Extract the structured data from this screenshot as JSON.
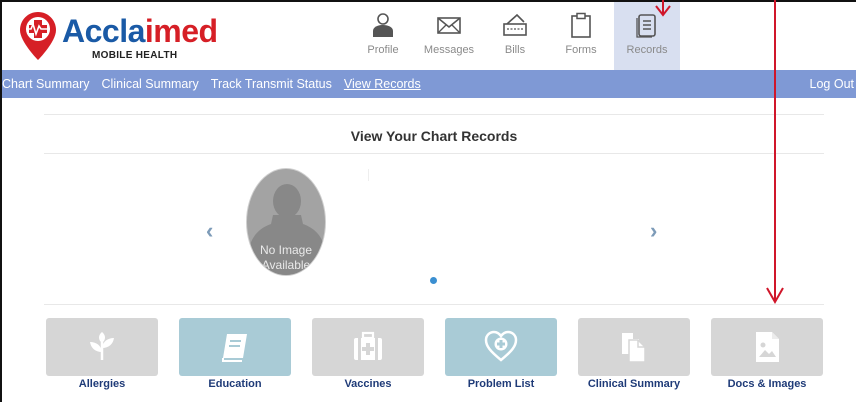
{
  "brand": {
    "name_part1": "Accla",
    "name_part2": "imed",
    "subtitle": "MOBILE HEALTH"
  },
  "nav_icons": [
    {
      "label": "Profile",
      "icon": "profile-icon"
    },
    {
      "label": "Messages",
      "icon": "envelope-icon"
    },
    {
      "label": "Bills",
      "icon": "bills-icon"
    },
    {
      "label": "Forms",
      "icon": "clipboard-icon"
    },
    {
      "label": "Records",
      "icon": "records-icon"
    }
  ],
  "menu": {
    "items": [
      "Chart Summary",
      "Clinical Summary",
      "Track Transmit Status",
      "View Records"
    ],
    "logout": "Log Out"
  },
  "page": {
    "title": "View Your Chart Records"
  },
  "carousel": {
    "no_image_line1": "No Image",
    "no_image_line2": "Available",
    "prev": "‹",
    "next": "›"
  },
  "tiles": [
    {
      "label": "Allergies",
      "icon": "leaf-icon",
      "color": "#d6d6d6"
    },
    {
      "label": "Education",
      "icon": "book-icon",
      "color": "#a9cbd6"
    },
    {
      "label": "Vaccines",
      "icon": "medkit-icon",
      "color": "#d6d6d6"
    },
    {
      "label": "Problem List",
      "icon": "heart-plus-icon",
      "color": "#a9cbd6"
    },
    {
      "label": "Clinical Summary",
      "icon": "documents-icon",
      "color": "#d6d6d6"
    },
    {
      "label": "Docs & Images",
      "icon": "image-file-icon",
      "color": "#d6d6d6"
    }
  ],
  "colors": {
    "menu_bar": "#7f99d5",
    "active_nav": "#d8dff0",
    "annotation_arrow": "#d0162a"
  }
}
